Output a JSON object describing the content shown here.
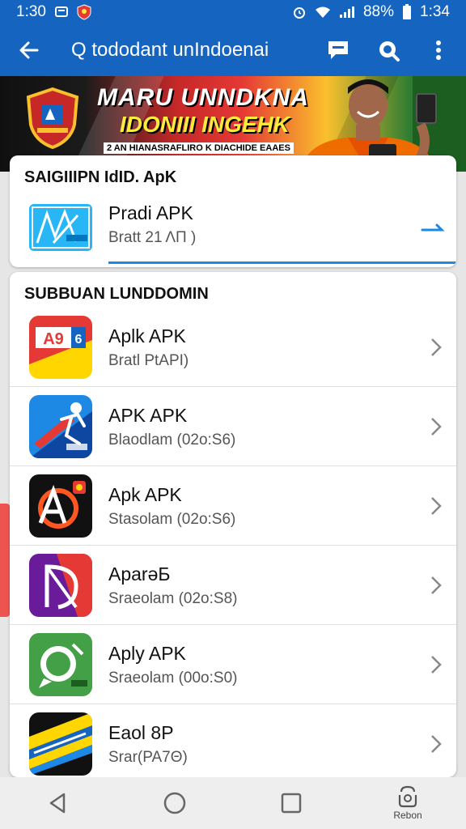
{
  "status_bar": {
    "time_left": "1:30",
    "battery_percent": "88%",
    "time_right": "1:34"
  },
  "app_bar": {
    "title": "Q tododant unIndoenai",
    "icons": [
      "back-arrow-icon",
      "chat-icon",
      "search-icon",
      "more-vert-icon"
    ]
  },
  "banner": {
    "title_line1": "MARU UNNDKNA",
    "title_line2": "IDONIII INGEHK",
    "subtitle": "2 AN HIANASRAFLIRO K DIACHIDE EAAES"
  },
  "featured": {
    "section_title": "SAIGIIIPN IdID. ApK",
    "app": {
      "name": "Pradi APK",
      "desc": "Bratt 21 ΛΠ )",
      "icon": "featured-app-icon"
    },
    "accent": "#1e88e5"
  },
  "list": {
    "section_title": "SUBBUAN LUNDDOMIN",
    "items": [
      {
        "name": "Aplk APK",
        "desc": "Bratl PtAPI)",
        "icon": "app-icon-red-yellow"
      },
      {
        "name": "APK APK",
        "desc": "Blaodlam (02o:S6)",
        "icon": "app-icon-blue-runner"
      },
      {
        "name": "Apk APK",
        "desc": "Stasolam (02o:S6)",
        "icon": "app-icon-dark-orange"
      },
      {
        "name": "AparəБ",
        "desc": "Sraeolam (02o:S8)",
        "icon": "app-icon-purple-red"
      },
      {
        "name": "Aply APK",
        "desc": "Sraeolam (00o:S0)",
        "icon": "app-icon-green-chat"
      },
      {
        "name": "Eaol 8P",
        "desc": "Srar(PA7Θ)",
        "icon": "app-icon-yellow-blue"
      }
    ]
  },
  "nav_bar": {
    "right_label": "Rebon"
  },
  "colors": {
    "primary": "#1565c0",
    "accent": "#1e88e5",
    "side_tab": "#ef5350"
  }
}
